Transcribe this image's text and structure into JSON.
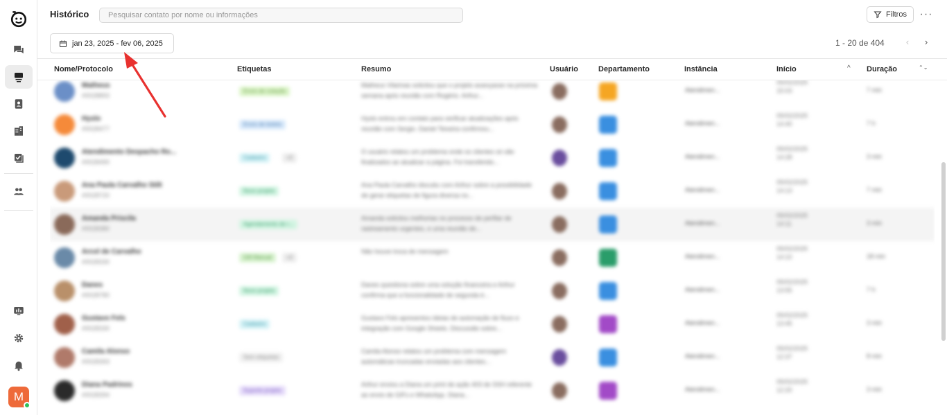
{
  "header": {
    "title": "Histórico",
    "search_placeholder": "Pesquisar contato por nome ou informações",
    "filters_label": "Filtros",
    "more_label": "···"
  },
  "toolbar": {
    "date_range": "jan 23, 2025 - fev 06, 2025",
    "pagination": "1 - 20 de 404",
    "prev": "‹",
    "next": "›"
  },
  "sidebar": {
    "user_initial": "M",
    "items": [
      "logo",
      "chat",
      "history",
      "contacts",
      "companies",
      "tasks",
      "groups",
      "reports",
      "settings",
      "notifications"
    ]
  },
  "table": {
    "columns": [
      "Nome/Protocolo",
      "Etiquetas",
      "Resumo",
      "Usuário",
      "Departamento",
      "Instância",
      "Início",
      "Duração"
    ],
    "sort_start": "^",
    "sort_duration": "⌃⌄",
    "rows": [
      {
        "name": "Matheus",
        "proto": "#0028893",
        "tag": "Envio de cotação",
        "tag_bg": "#dcf5c9",
        "tag_fg": "#6a9a4a",
        "extra": "",
        "summary": "Matheus Vilarinas solicitou que o projeto avançasse na próxima semana após reunião com Rogério. Arthur...",
        "avatar_color": "#6b8fc7",
        "user_color": "#8a6d60",
        "dept_color": "#f5a623",
        "instance": "Atendimen...",
        "start": "05/02/2025\n15:03",
        "duration": "7 min"
      },
      {
        "name": "Hyslo",
        "proto": "#0028477",
        "tag": "Envio de boleto",
        "tag_bg": "#d8e9fb",
        "tag_fg": "#4f7fb0",
        "extra": "",
        "summary": "Hyslo entrou em contato para verificar atualizações após reunião com Sergio. Daniel Teixeira confirmou...",
        "avatar_color": "#f58a3a",
        "user_color": "#8a6d60",
        "dept_color": "#3a8fe0",
        "instance": "Atendimen...",
        "start": "05/02/2025\n14:40",
        "duration": "7 h"
      },
      {
        "name": "Atendimento Despacho Ro...",
        "proto": "#0028490",
        "tag": "Cadastro",
        "tag_bg": "#d6f3f7",
        "tag_fg": "#3c98a8",
        "extra": "+2",
        "summary": "O usuário relatou um problema onde os clientes só são finalizados ao atualizar a página. Foi transferido...",
        "avatar_color": "#1e4a6e",
        "user_color": "#6a4e9e",
        "dept_color": "#3a8fe0",
        "instance": "Atendimen...",
        "start": "05/02/2025\n14:28",
        "duration": "3 min"
      },
      {
        "name": "Ana Paula Carvalho Stilt",
        "proto": "#0028720",
        "tag": "Novo projeto",
        "tag_bg": "#d3f5e3",
        "tag_fg": "#3a9a6a",
        "extra": "",
        "summary": "Ana Paula Carvalho discutiu com Arthur sobre a possibilidade de gerar etiquetas de figura diversa no...",
        "avatar_color": "#c99a7a",
        "user_color": "#8a6d60",
        "dept_color": "#3a8fe0",
        "instance": "Atendimen...",
        "start": "05/02/2025\n14:13",
        "duration": "7 min"
      },
      {
        "name": "Amanda Priscila",
        "proto": "#0028380",
        "tag": "Agendamento de r...",
        "tag_bg": "#d3f5e3",
        "tag_fg": "#3a9a6a",
        "extra": "",
        "summary": "Amanda solicitou melhorias no processo de perfilar de rastreamento urgentes, e uma reunião de...",
        "avatar_color": "#8a6a5a",
        "user_color": "#8a6d60",
        "dept_color": "#3a8fe0",
        "instance": "Atendimen...",
        "start": "05/02/2025\n14:11",
        "duration": "3 min"
      },
      {
        "name": "Arcol de Carvalho",
        "proto": "#0028330",
        "tag": "Gift Manual",
        "tag_bg": "#d9f3d0",
        "tag_fg": "#5a9a4a",
        "extra": "+2",
        "summary": "Não houve troca de mensagem",
        "avatar_color": "#6a8aa8",
        "user_color": "#8a6d60",
        "dept_color": "#2a9d6a",
        "instance": "Atendimen...",
        "start": "05/02/2025\n14:10",
        "duration": "18 min"
      },
      {
        "name": "Danes",
        "proto": "#0028780",
        "tag": "Novo projeto",
        "tag_bg": "#d3f5e3",
        "tag_fg": "#3a9a6a",
        "extra": "",
        "summary": "Danes questiona sobre uma solução financeira e Arthur confirma que a funcionalidade de segunda é...",
        "avatar_color": "#b9906a",
        "user_color": "#8a6d60",
        "dept_color": "#3a8fe0",
        "instance": "Atendimen...",
        "start": "05/02/2025\n13:55",
        "duration": "7 h"
      },
      {
        "name": "Gustavo Fels",
        "proto": "#0028330",
        "tag": "Cadastro",
        "tag_bg": "#d6f3f7",
        "tag_fg": "#3c98a8",
        "extra": "",
        "summary": "Gustavo Fels apresentou ideias de automação de fluxo e integração com Google Sheets. Discussão sobre...",
        "avatar_color": "#a0604a",
        "user_color": "#8a6d60",
        "dept_color": "#a24ac7",
        "instance": "Atendimen...",
        "start": "05/02/2025\n13:45",
        "duration": "3 min"
      },
      {
        "name": "Camila Alonso",
        "proto": "#0028393",
        "tag": "Sem etiquetas",
        "tag_bg": "#f0f0f0",
        "tag_fg": "#888888",
        "extra": "",
        "summary": "Camila Alonso relatou um problema com mensagem automáticas truncadas enviadas aos clientes...",
        "avatar_color": "#b07a6a",
        "user_color": "#6a4e9e",
        "dept_color": "#3a8fe0",
        "instance": "Atendimen...",
        "start": "05/02/2025\n12:37",
        "duration": "8 min"
      },
      {
        "name": "Diana Padrinos",
        "proto": "#0028394",
        "tag": "Suporte projeto",
        "tag_bg": "#e6dcfa",
        "tag_fg": "#7a5ac0",
        "extra": "",
        "summary": "Arthur enviou a Diana um print de ação 403 de SSH referente ao envio de GIFs e WhatsApp. Diana...",
        "avatar_color": "#2a2a2a",
        "user_color": "#8a6d60",
        "dept_color": "#a24ac7",
        "instance": "Atendimen...",
        "start": "05/02/2025\n12:20",
        "duration": "3 min"
      }
    ]
  }
}
